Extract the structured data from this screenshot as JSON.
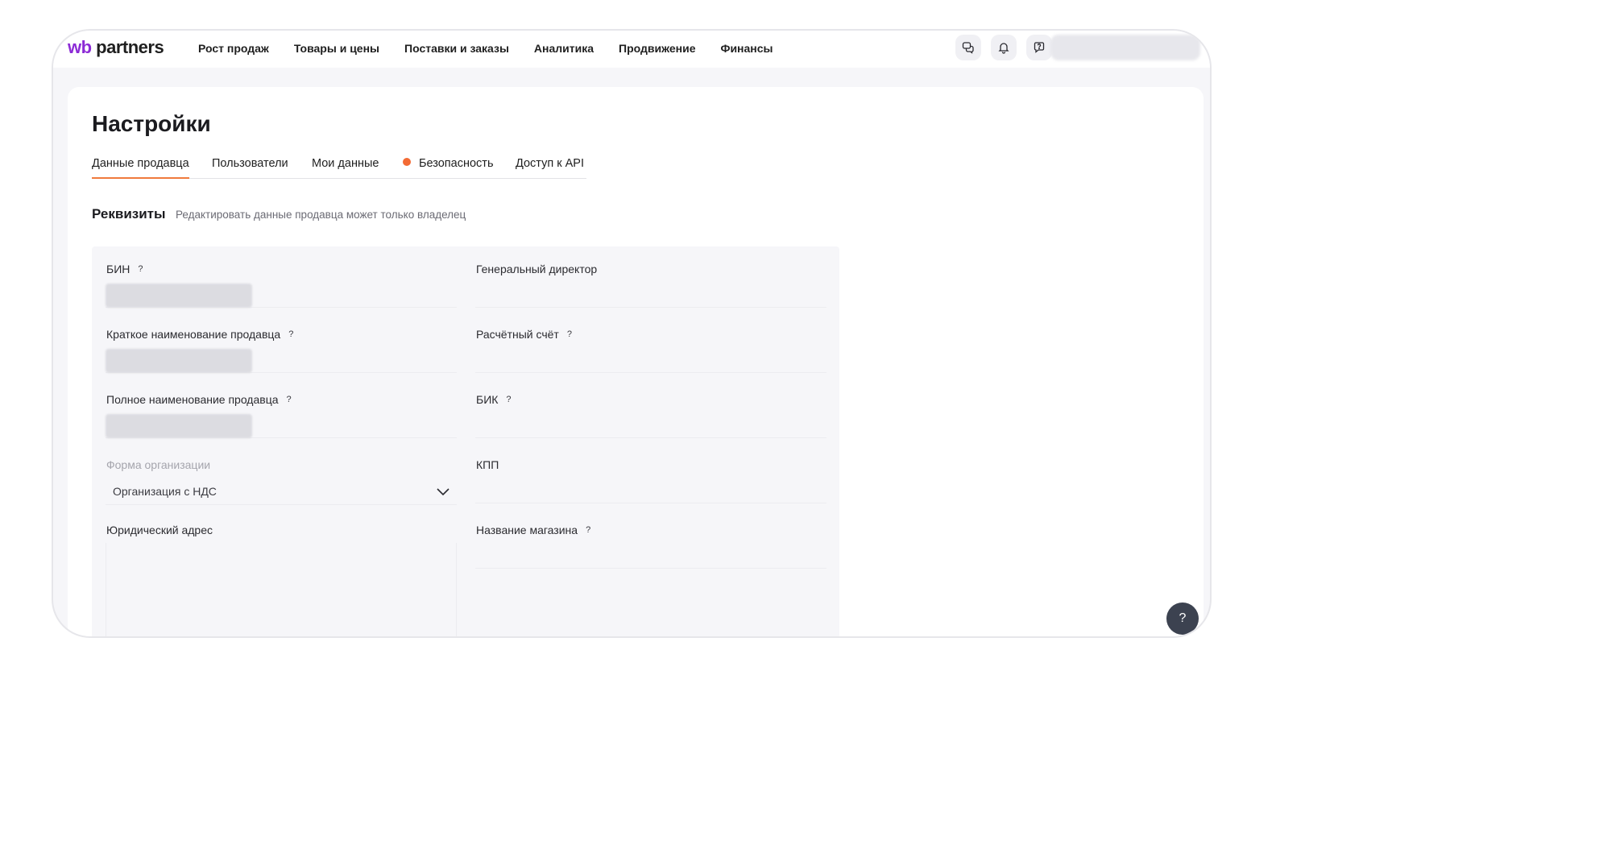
{
  "header": {
    "logo_wb": "wb",
    "logo_rest": " partners",
    "nav": [
      {
        "label": "Рост продаж"
      },
      {
        "label": "Товары и цены"
      },
      {
        "label": "Поставки и заказы"
      },
      {
        "label": "Аналитика"
      },
      {
        "label": "Продвижение"
      },
      {
        "label": "Финансы"
      }
    ],
    "icons": [
      "chat-icon",
      "bell-icon",
      "feedback-icon"
    ]
  },
  "page": {
    "title": "Настройки",
    "tabs": [
      {
        "label": "Данные продавца",
        "active": true
      },
      {
        "label": "Пользователи"
      },
      {
        "label": "Мои данные"
      },
      {
        "label": "Безопасность",
        "dot_color": "#f36b34"
      },
      {
        "label": "Доступ к API"
      }
    ]
  },
  "section": {
    "title": "Реквизиты",
    "note": "Редактировать данные продавца может только владелец"
  },
  "form": {
    "left": [
      {
        "label": "БИН",
        "help": "?"
      },
      {
        "label": "Краткое наименование продавца",
        "help": "?"
      },
      {
        "label": "Полное наименование продавца",
        "help": "?"
      },
      {
        "label": "Форма организации",
        "value": "Организация с НДС"
      },
      {
        "label": "Юридический адрес"
      }
    ],
    "right": [
      {
        "label": "Генеральный директор"
      },
      {
        "label": "Расчётный счёт",
        "help": "?"
      },
      {
        "label": "БИК",
        "help": "?"
      },
      {
        "label": "КПП"
      },
      {
        "label": "Название магазина",
        "help": "?"
      }
    ]
  },
  "fab": {
    "label": "?"
  },
  "colors": {
    "accent": "#f07a3c",
    "brand": "#8c2bd6",
    "fab": "#3c4250"
  }
}
